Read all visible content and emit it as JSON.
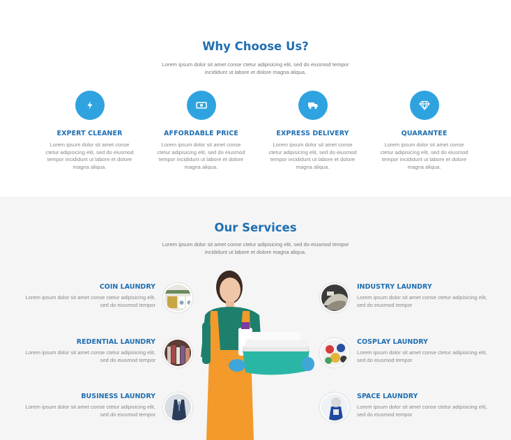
{
  "why": {
    "title": "Why Choose Us?",
    "subtitle": "Lorem ipsum dolor sit amet conse ctetur adipisicing elit, sed do eiusmod tempor incididunt ut labore et dolore magna aliqua.",
    "features": [
      {
        "icon": "lightning-icon",
        "title": "EXPERT CLEANER",
        "desc": "Lorem ipsum dolor sit amet conse ctetur adipisicing elit, sed do eiusmod tempor incididunt ut labore et dolore magna aliqua."
      },
      {
        "icon": "money-icon",
        "title": "AFFORDABLE PRICE",
        "desc": "Lorem ipsum dolor sit amet conse ctetur adipisicing elit, sed do eiusmod tempor incididunt ut labore et dolore magna aliqua."
      },
      {
        "icon": "truck-icon",
        "title": "EXPRESS DELIVERY",
        "desc": "Lorem ipsum dolor sit amet conse ctetur adipisicing elit, sed do eiusmod tempor incididunt ut labore et dolore magna aliqua."
      },
      {
        "icon": "diamond-icon",
        "title": "QUARANTEE",
        "desc": "Lorem ipsum dolor sit amet conse ctetur adipisicing elit, sed do eiusmod tempor incididunt ut labore et dolore magna aliqua."
      }
    ]
  },
  "services": {
    "title": "Our Services",
    "subtitle": "Lorem ipsum dolor sit amet conse ctetur adipisicing elit, sed do eiusmod tempor incididunt ut labore et dolore magna aliqua.",
    "left": [
      {
        "title": "COIN LAUNDRY",
        "desc": "Lorem ipsum dolor sit amet conse ctetur adipisicing elit, sed do eiusmod tempor"
      },
      {
        "title": "REDENTIAL LAUNDRY",
        "desc": "Lorem ipsum dolor sit amet conse ctetur adipisicing elit, sed do eiusmod tempor"
      },
      {
        "title": "BUSINESS LAUNDRY",
        "desc": "Lorem ipsum dolor sit amet conse ctetur adipisicing elit, sed do eiusmod tempor"
      }
    ],
    "right": [
      {
        "title": "INDUSTRY LAUNDRY",
        "desc": "Lorem ipsum dolor sit amet conse ctetur adipisicing elit, sed do eiusmod tempor"
      },
      {
        "title": "COSPLAY LAUNDRY",
        "desc": "Lorem ipsum dolor sit amet conse ctetur adipisicing elit, sed do eiusmod tempor"
      },
      {
        "title": "SPACE LAUNDRY",
        "desc": "Lorem ipsum dolor sit amet conse ctetur adipisicing elit, sed do eiusmod tempor"
      }
    ]
  },
  "colors": {
    "accent": "#2fa3e0",
    "heading": "#1f6fb2",
    "section_bg": "#f5f5f5"
  }
}
